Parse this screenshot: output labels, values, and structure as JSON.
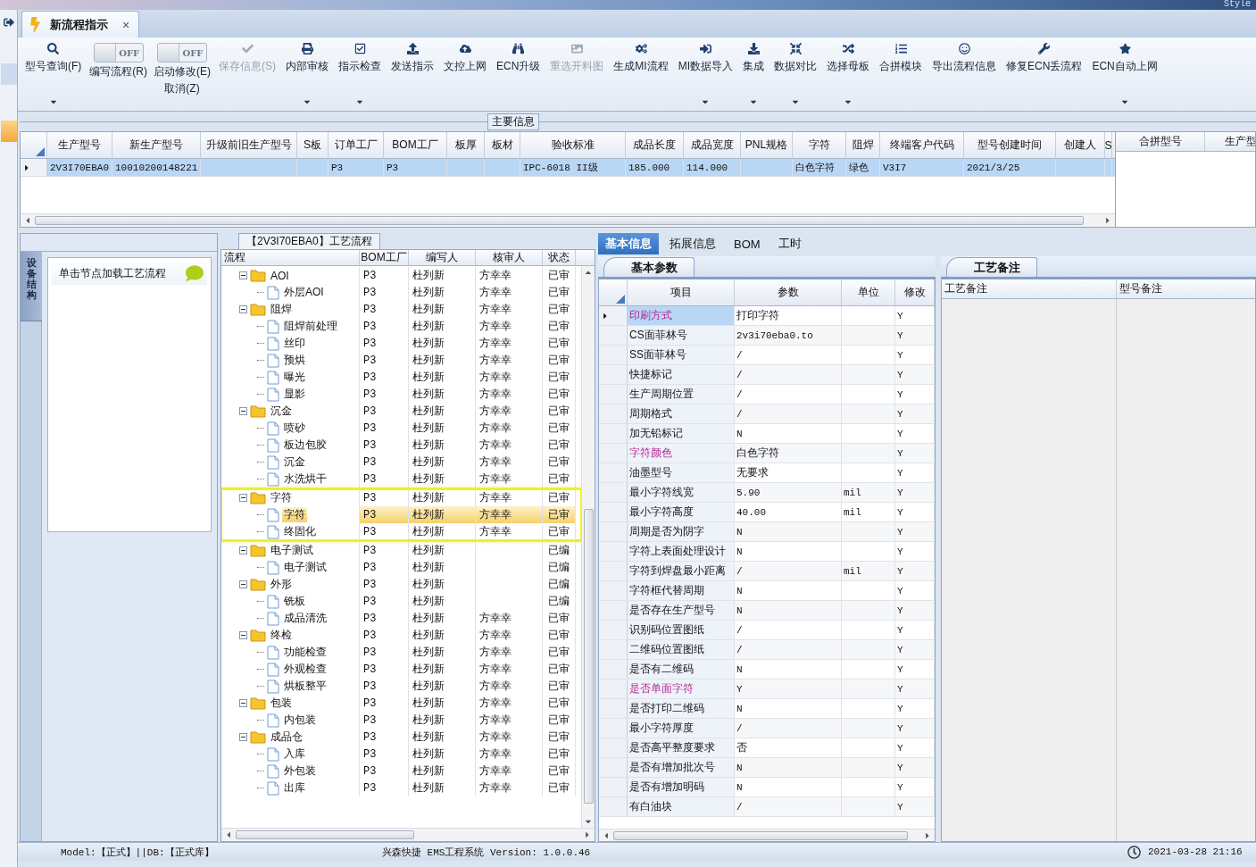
{
  "top_strip": {
    "label": "Style"
  },
  "tab": {
    "title": "新流程指示",
    "close": "×"
  },
  "toolbar": [
    {
      "kind": "button",
      "label": "型号查询(F)",
      "disabled": false,
      "dropdown": true
    },
    {
      "kind": "toggle",
      "label": "编写流程(R)",
      "toggle_text": "OFF",
      "on": false
    },
    {
      "kind": "toggle",
      "label": "启动修改(E)",
      "sublabel": "取消(Z)",
      "toggle_text": "OFF",
      "on": false
    },
    {
      "kind": "button",
      "label": "保存信息(S)",
      "disabled": true,
      "dropdown": false
    },
    {
      "kind": "button",
      "label": "内部审核",
      "disabled": false,
      "dropdown": true
    },
    {
      "kind": "button",
      "label": "指示检查",
      "disabled": false,
      "dropdown": true
    },
    {
      "kind": "button",
      "label": "发送指示",
      "disabled": false,
      "dropdown": false
    },
    {
      "kind": "button",
      "label": "文控上网",
      "disabled": false,
      "dropdown": false
    },
    {
      "kind": "button",
      "label": "ECN升级",
      "disabled": false,
      "dropdown": false
    },
    {
      "kind": "button",
      "label": "重选开料图",
      "disabled": true,
      "dropdown": false
    },
    {
      "kind": "button",
      "label": "生成MI流程",
      "disabled": false,
      "dropdown": false
    },
    {
      "kind": "button",
      "label": "MI数据导入",
      "disabled": false,
      "dropdown": true
    },
    {
      "kind": "button",
      "label": "集成",
      "disabled": false,
      "dropdown": true
    },
    {
      "kind": "button",
      "label": "数据对比",
      "disabled": false,
      "dropdown": true
    },
    {
      "kind": "button",
      "label": "选择母板",
      "disabled": false,
      "dropdown": true
    },
    {
      "kind": "button",
      "label": "合拼模块",
      "disabled": false,
      "dropdown": false
    },
    {
      "kind": "button",
      "label": "导出流程信息",
      "disabled": false,
      "dropdown": false
    },
    {
      "kind": "button",
      "label": "修复ECN丢流程",
      "disabled": false,
      "dropdown": false
    },
    {
      "kind": "button",
      "label": "ECN自动上网",
      "disabled": false,
      "dropdown": true
    }
  ],
  "main_info": {
    "legend": "主要信息",
    "columns": [
      "生产型号",
      "新生产型号",
      "升级前旧生产型号",
      "S板",
      "订单工厂",
      "BOM工厂",
      "板厚",
      "板材",
      "验收标准",
      "成品长度",
      "成品宽度",
      "PNL规格",
      "字符",
      "阻焊",
      "终端客户代码",
      "型号创建时间",
      "创建人",
      "S"
    ],
    "rows": [
      {
        "selected": true,
        "cells": [
          "2V3I70EBA0",
          "10010200148221",
          null,
          null,
          "P3",
          "P3",
          null,
          null,
          "IPC-6018 II级",
          "185.000",
          "114.000",
          null,
          "白色字符",
          "绿色",
          "V3I7",
          "2021/3/25",
          null,
          null
        ]
      }
    ],
    "side_columns": [
      "合拼型号",
      "生产型"
    ]
  },
  "left_panel": {
    "vertical_tab": "设备结构",
    "item": "单击节点加载工艺流程"
  },
  "tree": {
    "title": "【2V3I70EBA0】工艺流程",
    "columns": [
      "流程",
      "BOM工厂",
      "编写人",
      "核审人",
      "状态"
    ],
    "nodes": [
      {
        "label": "AOI",
        "bom": "P3",
        "writer": "杜列新",
        "reviewer": "方幸幸",
        "status": "已审",
        "expanded": true,
        "selected": false,
        "highlighted": false,
        "children": [
          {
            "label": "外层AOI",
            "bom": "P3",
            "writer": "杜列新",
            "reviewer": "方幸幸",
            "status": "已审",
            "selected": false
          }
        ]
      },
      {
        "label": "阻焊",
        "bom": "P3",
        "writer": "杜列新",
        "reviewer": "方幸幸",
        "status": "已审",
        "expanded": true,
        "selected": false,
        "highlighted": false,
        "children": [
          {
            "label": "阻焊前处理",
            "bom": "P3",
            "writer": "杜列新",
            "reviewer": "方幸幸",
            "status": "已审",
            "selected": false
          },
          {
            "label": "丝印",
            "bom": "P3",
            "writer": "杜列新",
            "reviewer": "方幸幸",
            "status": "已审",
            "selected": false
          },
          {
            "label": "预烘",
            "bom": "P3",
            "writer": "杜列新",
            "reviewer": "方幸幸",
            "status": "已审",
            "selected": false
          },
          {
            "label": "曝光",
            "bom": "P3",
            "writer": "杜列新",
            "reviewer": "方幸幸",
            "status": "已审",
            "selected": false
          },
          {
            "label": "显影",
            "bom": "P3",
            "writer": "杜列新",
            "reviewer": "方幸幸",
            "status": "已审",
            "selected": false
          }
        ]
      },
      {
        "label": "沉金",
        "bom": "P3",
        "writer": "杜列新",
        "reviewer": "方幸幸",
        "status": "已审",
        "expanded": true,
        "selected": false,
        "highlighted": false,
        "children": [
          {
            "label": "喷砂",
            "bom": "P3",
            "writer": "杜列新",
            "reviewer": "方幸幸",
            "status": "已审",
            "selected": false
          },
          {
            "label": "板边包胶",
            "bom": "P3",
            "writer": "杜列新",
            "reviewer": "方幸幸",
            "status": "已审",
            "selected": false
          },
          {
            "label": "沉金",
            "bom": "P3",
            "writer": "杜列新",
            "reviewer": "方幸幸",
            "status": "已审",
            "selected": false
          },
          {
            "label": "水洗烘干",
            "bom": "P3",
            "writer": "杜列新",
            "reviewer": "方幸幸",
            "status": "已审",
            "selected": false
          }
        ]
      },
      {
        "label": "字符",
        "bom": "P3",
        "writer": "杜列新",
        "reviewer": "方幸幸",
        "status": "已审",
        "expanded": true,
        "selected": false,
        "highlighted": true,
        "children": [
          {
            "label": "字符",
            "bom": "P3",
            "writer": "杜列新",
            "reviewer": "方幸幸",
            "status": "已审",
            "selected": true
          },
          {
            "label": "终固化",
            "bom": "P3",
            "writer": "杜列新",
            "reviewer": "方幸幸",
            "status": "已审",
            "selected": false
          }
        ]
      },
      {
        "label": "电子测试",
        "bom": "P3",
        "writer": "杜列新",
        "status": "已编",
        "expanded": true,
        "selected": false,
        "highlighted": false,
        "children": [
          {
            "label": "电子测试",
            "bom": "P3",
            "writer": "杜列新",
            "status": "已编",
            "selected": false
          }
        ]
      },
      {
        "label": "外形",
        "bom": "P3",
        "writer": "杜列新",
        "status": "已编",
        "expanded": true,
        "selected": false,
        "highlighted": false,
        "children": [
          {
            "label": "铣板",
            "bom": "P3",
            "writer": "杜列新",
            "status": "已编",
            "selected": false
          },
          {
            "label": "成品清洗",
            "bom": "P3",
            "writer": "杜列新",
            "reviewer": "方幸幸",
            "status": "已审",
            "selected": false
          }
        ]
      },
      {
        "label": "终检",
        "bom": "P3",
        "writer": "杜列新",
        "reviewer": "方幸幸",
        "status": "已审",
        "expanded": true,
        "selected": false,
        "highlighted": false,
        "children": [
          {
            "label": "功能检查",
            "bom": "P3",
            "writer": "杜列新",
            "reviewer": "方幸幸",
            "status": "已审",
            "selected": false
          },
          {
            "label": "外观检查",
            "bom": "P3",
            "writer": "杜列新",
            "reviewer": "方幸幸",
            "status": "已审",
            "selected": false
          },
          {
            "label": "烘板整平",
            "bom": "P3",
            "writer": "杜列新",
            "reviewer": "方幸幸",
            "status": "已审",
            "selected": false
          }
        ]
      },
      {
        "label": "包装",
        "bom": "P3",
        "writer": "杜列新",
        "reviewer": "方幸幸",
        "status": "已审",
        "expanded": true,
        "selected": false,
        "highlighted": false,
        "children": [
          {
            "label": "内包装",
            "bom": "P3",
            "writer": "杜列新",
            "reviewer": "方幸幸",
            "status": "已审",
            "selected": false
          }
        ]
      },
      {
        "label": "成品仓",
        "bom": "P3",
        "writer": "杜列新",
        "reviewer": "方幸幸",
        "status": "已审",
        "expanded": true,
        "selected": false,
        "highlighted": false,
        "children": [
          {
            "label": "入库",
            "bom": "P3",
            "writer": "杜列新",
            "reviewer": "方幸幸",
            "status": "已审",
            "selected": false
          },
          {
            "label": "外包装",
            "bom": "P3",
            "writer": "杜列新",
            "reviewer": "方幸幸",
            "status": "已审",
            "selected": false
          },
          {
            "label": "出库",
            "bom": "P3",
            "writer": "杜列新",
            "reviewer": "方幸幸",
            "status": "已审",
            "selected": false
          }
        ]
      }
    ]
  },
  "detail": {
    "tabs": [
      {
        "label": "基本信息",
        "selected": true
      },
      {
        "label": "拓展信息",
        "selected": false
      },
      {
        "label": "BOM",
        "selected": false
      },
      {
        "label": "工时",
        "selected": false
      }
    ],
    "params_tab": "基本参数",
    "param_columns": [
      "项目",
      "参数",
      "单位",
      "修改"
    ],
    "params": [
      {
        "item": "印刷方式",
        "value": "打印字符",
        "modified": "Y",
        "emphasized": true,
        "selected": true
      },
      {
        "item": "CS面菲林号",
        "value": "2v3i70eba0.to",
        "modified": "Y",
        "emphasized": false,
        "selected": false
      },
      {
        "item": "SS面菲林号",
        "value": "/",
        "modified": "Y",
        "emphasized": false,
        "selected": false
      },
      {
        "item": "快捷标记",
        "value": "/",
        "modified": "Y",
        "emphasized": false,
        "selected": false
      },
      {
        "item": "生产周期位置",
        "value": "/",
        "modified": "Y",
        "emphasized": false,
        "selected": false
      },
      {
        "item": "周期格式",
        "value": "/",
        "modified": "Y",
        "emphasized": false,
        "selected": false
      },
      {
        "item": "加无铅标记",
        "value": "N",
        "modified": "Y",
        "emphasized": false,
        "selected": false
      },
      {
        "item": "字符颜色",
        "value": "白色字符",
        "modified": "Y",
        "emphasized": true,
        "selected": false
      },
      {
        "item": "油墨型号",
        "value": "无要求",
        "modified": "Y",
        "emphasized": false,
        "selected": false
      },
      {
        "item": "最小字符线宽",
        "value": "5.90",
        "unit": "mil",
        "modified": "Y",
        "emphasized": false,
        "selected": false
      },
      {
        "item": "最小字符高度",
        "value": "40.00",
        "unit": "mil",
        "modified": "Y",
        "emphasized": false,
        "selected": false
      },
      {
        "item": "周期是否为阴字",
        "value": "N",
        "modified": "Y",
        "emphasized": false,
        "selected": false
      },
      {
        "item": "字符上表面处理设计",
        "value": "N",
        "modified": "Y",
        "emphasized": false,
        "selected": false
      },
      {
        "item": "字符到焊盘最小距离",
        "value": "/",
        "unit": "mil",
        "modified": "Y",
        "emphasized": false,
        "selected": false
      },
      {
        "item": "字符框代替周期",
        "value": "N",
        "modified": "Y",
        "emphasized": false,
        "selected": false
      },
      {
        "item": "是否存在生产型号",
        "value": "N",
        "modified": "Y",
        "emphasized": false,
        "selected": false
      },
      {
        "item": "识别码位置图纸",
        "value": "/",
        "modified": "Y",
        "emphasized": false,
        "selected": false
      },
      {
        "item": "二维码位置图纸",
        "value": "/",
        "modified": "Y",
        "emphasized": false,
        "selected": false
      },
      {
        "item": "是否有二维码",
        "value": "N",
        "modified": "Y",
        "emphasized": false,
        "selected": false
      },
      {
        "item": "是否单面字符",
        "value": "Y",
        "modified": "Y",
        "emphasized": true,
        "selected": false
      },
      {
        "item": "是否打印二维码",
        "value": "N",
        "modified": "Y",
        "emphasized": false,
        "selected": false
      },
      {
        "item": "最小字符厚度",
        "value": "/",
        "modified": "Y",
        "emphasized": false,
        "selected": false
      },
      {
        "item": "是否高平整度要求",
        "value": "否",
        "modified": "Y",
        "emphasized": false,
        "selected": false
      },
      {
        "item": "是否有增加批次号",
        "value": "N",
        "modified": "Y",
        "emphasized": false,
        "selected": false
      },
      {
        "item": "是否有增加明码",
        "value": "N",
        "modified": "Y",
        "emphasized": false,
        "selected": false
      },
      {
        "item": "有白油块",
        "value": "/",
        "modified": "Y",
        "emphasized": false,
        "selected": false
      }
    ],
    "notes_tab": "工艺备注",
    "notes_columns": [
      "工艺备注",
      "型号备注"
    ]
  },
  "status_bar": {
    "model": "Model:【正式】||DB:【正式库】",
    "app": "兴森快捷 EMS工程系统 Version: 1.0.0.46",
    "time": "2021-03-28 21:16"
  }
}
